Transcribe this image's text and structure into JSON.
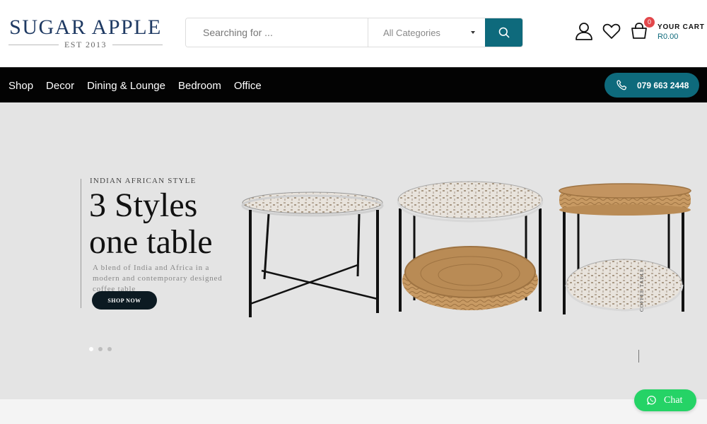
{
  "brand": {
    "name": "SUGAR APPLE",
    "est": "EST 2013"
  },
  "search": {
    "placeholder": "Searching for ...",
    "category": "All Categories"
  },
  "header": {
    "icons": [
      "user-icon",
      "heart-icon",
      "cart-icon"
    ],
    "cart": {
      "badge": "0",
      "label": "YOUR CART",
      "amount": "R0.00"
    }
  },
  "nav": {
    "links": [
      "Shop",
      "Decor",
      "Dining & Lounge",
      "Bedroom",
      "Office"
    ],
    "phone": "079 663 2448"
  },
  "hero": {
    "eyebrow": "INDIAN AFRICAN STYLE",
    "title_line1": "3 Styles",
    "title_line2": "one table",
    "description": "A blend of India and Africa in a modern and contemporary designed coffee table",
    "button": "SHOP NOW",
    "side_label": "COFFEE TABLE",
    "slides": 3,
    "active_slide": 1
  },
  "chat": {
    "label": "Chat"
  },
  "colors": {
    "accent": "#0e6a7c",
    "brand": "#1f3a63",
    "nav_bg": "#030303",
    "hero_bg": "#e4e4e4",
    "chat": "#25d366",
    "badge": "#e2474b"
  }
}
